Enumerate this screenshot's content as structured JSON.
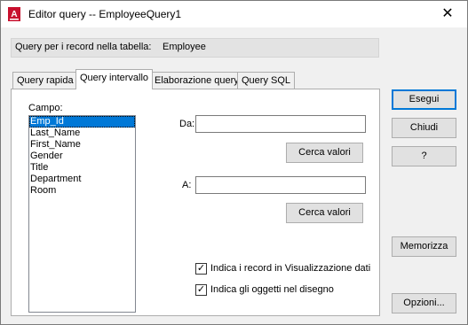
{
  "window": {
    "title": "Editor query -- EmployeeQuery1",
    "app_icon": "autocad-icon",
    "close_glyph": "✕"
  },
  "info": {
    "label": "Query per i record nella tabella:",
    "table": "Employee"
  },
  "tabs": [
    {
      "label": "Query rapida",
      "active": false
    },
    {
      "label": "Query intervallo",
      "active": true
    },
    {
      "label": "Elaborazione query",
      "active": false
    },
    {
      "label": "Query SQL",
      "active": false
    }
  ],
  "range": {
    "field_label": "Campo:",
    "fields": [
      "Emp_Id",
      "Last_Name",
      "First_Name",
      "Gender",
      "Title",
      "Department",
      "Room"
    ],
    "selected_field": "Emp_Id",
    "from_label": "Da:",
    "from_value": "",
    "to_label": "A:",
    "to_value": "",
    "lookup_label": "Cerca valori",
    "check_indicate_records": {
      "label": "Indica i record in Visualizzazione dati",
      "checked": true
    },
    "check_indicate_objects": {
      "label": "Indica gli oggetti nel disegno",
      "checked": true
    }
  },
  "buttons": {
    "execute": "Esegui",
    "close": "Chiudi",
    "help": "?",
    "store": "Memorizza",
    "options": "Opzioni..."
  },
  "colors": {
    "accent": "#0078d7",
    "selection": "#0078d7",
    "app_icon": "#c8102e"
  }
}
